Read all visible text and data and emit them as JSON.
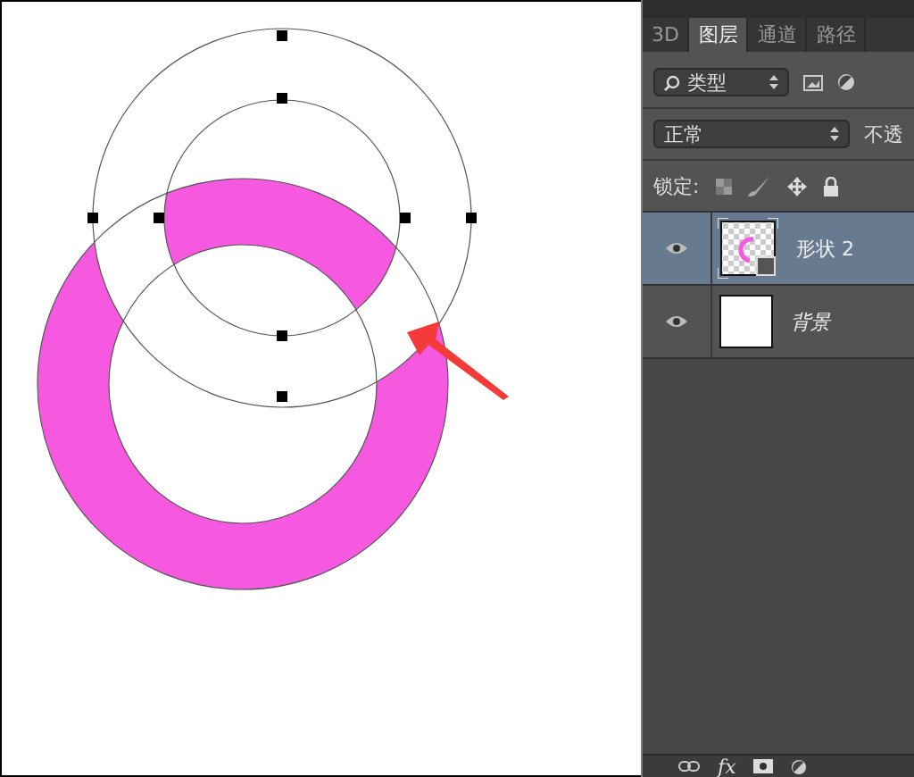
{
  "tabs": [
    {
      "label": "3D",
      "selected": false
    },
    {
      "label": "图层",
      "selected": true
    },
    {
      "label": "通道",
      "selected": false
    },
    {
      "label": "路径",
      "selected": false
    }
  ],
  "filter": {
    "value": "类型"
  },
  "blend_mode": {
    "value": "正常"
  },
  "opacity_label": "不透",
  "lock_label": "锁定:",
  "layers": [
    {
      "name": "形状 2",
      "kind": "shape",
      "selected": true,
      "visible": true
    },
    {
      "name": "背景",
      "kind": "background",
      "selected": false,
      "visible": true
    }
  ],
  "footer": {
    "fx_label": "fx"
  }
}
